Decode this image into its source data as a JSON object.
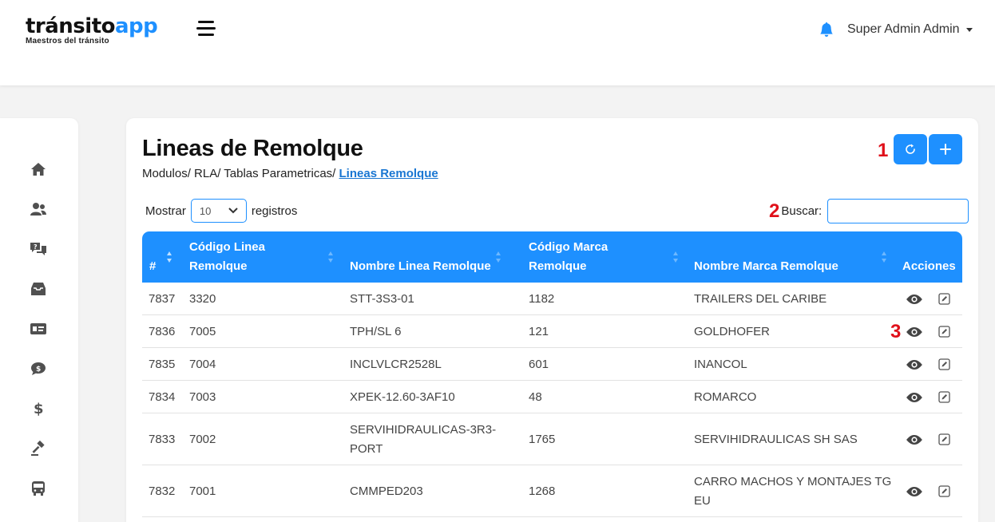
{
  "header": {
    "logo_dark": "tránsito",
    "logo_blue": "app",
    "logo_tagline": "Maestros del tránsito",
    "user_name": "Super Admin Admin"
  },
  "page": {
    "title": "Lineas de Remolque",
    "breadcrumb_path": "Modulos/ RLA/ Tablas Parametricas/",
    "breadcrumb_current": "Lineas Remolque",
    "annotations": [
      "1",
      "2",
      "3"
    ]
  },
  "controls": {
    "show_label": "Mostrar",
    "page_size": "10",
    "records_label": "registros",
    "search_label": "Buscar:",
    "search_value": ""
  },
  "table": {
    "columns": [
      "#",
      "Código Linea Remolque",
      "Nombre Linea Remolque",
      "Código Marca Remolque",
      "Nombre Marca Remolque",
      "Acciones"
    ],
    "rows": [
      {
        "id": "7837",
        "code": "3320",
        "name": "STT-3S3-01",
        "brand_code": "1182",
        "brand_name": "TRAILERS DEL CARIBE"
      },
      {
        "id": "7836",
        "code": "7005",
        "name": "TPH/SL 6",
        "brand_code": "121",
        "brand_name": "GOLDHOFER"
      },
      {
        "id": "7835",
        "code": "7004",
        "name": "INCLVLCR2528L",
        "brand_code": "601",
        "brand_name": "INANCOL"
      },
      {
        "id": "7834",
        "code": "7003",
        "name": "XPEK-12.60-3AF10",
        "brand_code": "48",
        "brand_name": "ROMARCO"
      },
      {
        "id": "7833",
        "code": "7002",
        "name": "SERVIHIDRAULICAS-3R3-PORT",
        "brand_code": "1765",
        "brand_name": "SERVIHIDRAULICAS SH SAS"
      },
      {
        "id": "7832",
        "code": "7001",
        "name": "CMMPED203",
        "brand_code": "1268",
        "brand_name": "CARRO MACHOS Y MONTAJES TG EU"
      }
    ]
  },
  "sidebar_icons": [
    "home-icon",
    "users-icon",
    "chat-icon",
    "inbox-icon",
    "id-card-icon",
    "money-bubble-icon",
    "dollar-icon",
    "gavel-icon",
    "bus-icon"
  ],
  "colors": {
    "accent": "#1e90ff",
    "annotation": "#e0101a"
  }
}
